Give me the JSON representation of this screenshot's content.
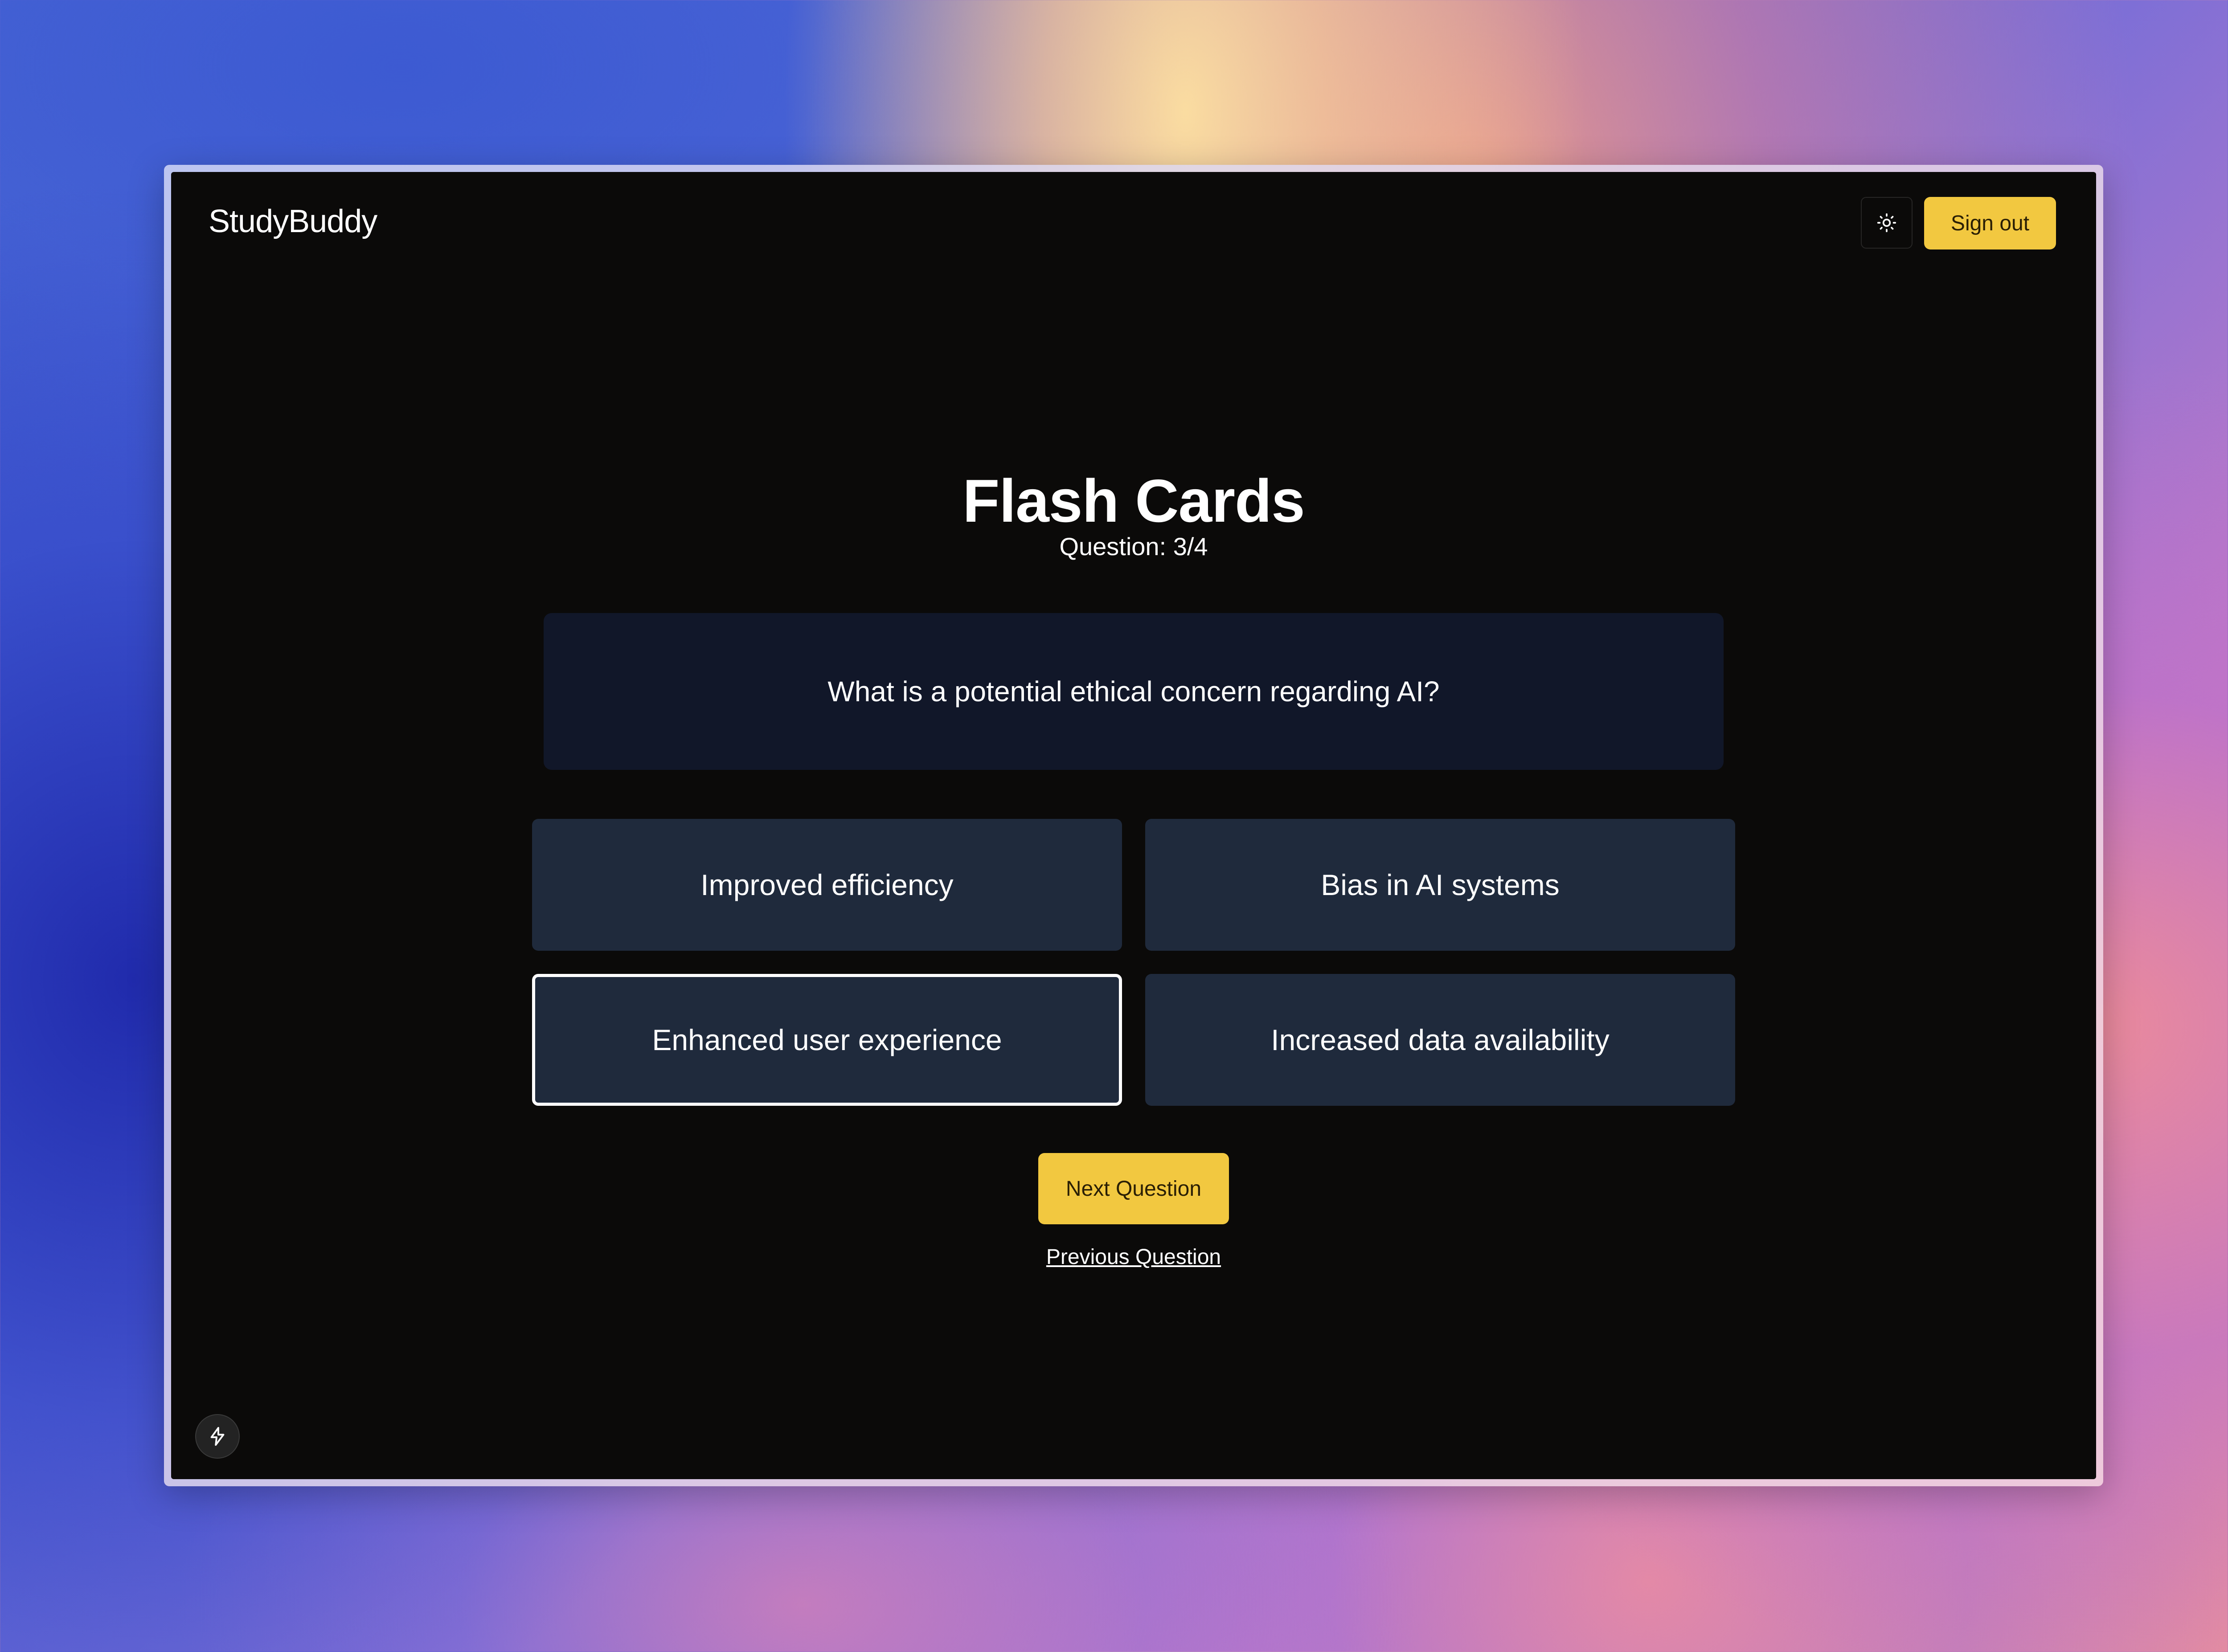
{
  "header": {
    "brand": "StudyBuddy",
    "theme_toggle_icon": "sun-icon",
    "sign_out_label": "Sign out"
  },
  "main": {
    "title": "Flash Cards",
    "question_counter": "Question: 3/4",
    "question_text": "What is a potential ethical concern regarding AI?",
    "options": [
      {
        "label": "Improved efficiency",
        "selected": false
      },
      {
        "label": "Bias in AI systems",
        "selected": false
      },
      {
        "label": "Enhanced user experience",
        "selected": true
      },
      {
        "label": "Increased data availability",
        "selected": false
      }
    ],
    "next_label": "Next Question",
    "previous_label": "Previous Question"
  },
  "footer": {
    "dev_indicator_icon": "lightning-icon"
  },
  "colors": {
    "accent": "#f2c840",
    "page_background": "#0b0a09",
    "card_background": "#111729",
    "option_background": "#1f2a3c",
    "text": "#ffffff"
  }
}
